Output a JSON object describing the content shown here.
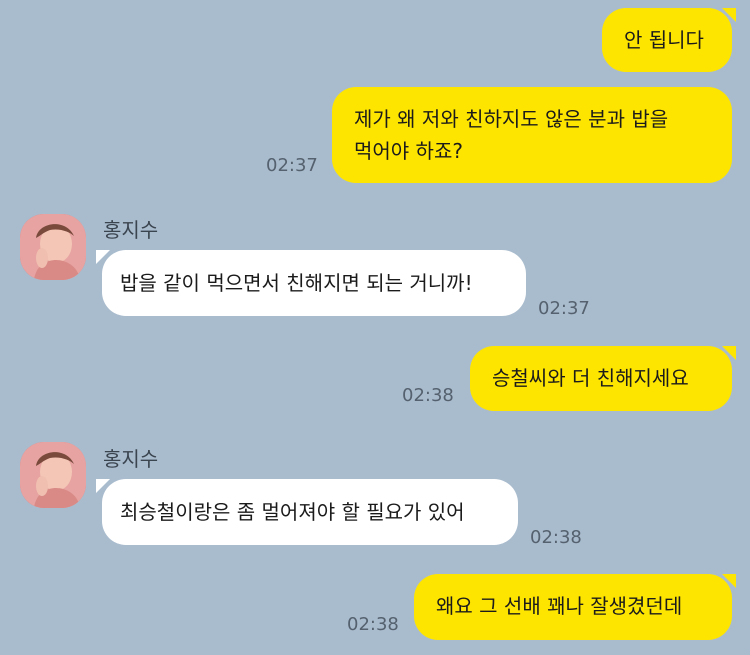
{
  "messages": [
    {
      "side": "out",
      "text": "안 됩니다",
      "time": ""
    },
    {
      "side": "out",
      "line1": "제가 왜 저와 친하지도 않은 분과 밥을",
      "line2": "먹어야 하죠?",
      "time": "02:37"
    },
    {
      "side": "in",
      "sender": "홍지수",
      "text": "밥을 같이 먹으면서 친해지면 되는 거니까!",
      "time": "02:37"
    },
    {
      "side": "out",
      "text": "승철씨와 더 친해지세요",
      "time": "02:38"
    },
    {
      "side": "in",
      "sender": "홍지수",
      "text": "최승철이랑은 좀 멀어져야 할 필요가 있어",
      "time": "02:38"
    },
    {
      "side": "out",
      "text": "왜요 그 선배 꽤나 잘생겼던데",
      "time": "02:38"
    }
  ],
  "colors": {
    "background": "#a9bcce",
    "outgoing_bubble": "#fee500",
    "incoming_bubble": "#ffffff"
  },
  "icons": {
    "avatar": "profile-photo-avatar"
  }
}
